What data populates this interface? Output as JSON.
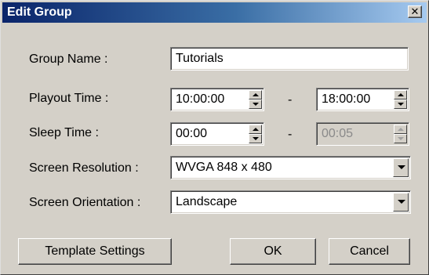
{
  "window": {
    "title": "Edit Group",
    "close_glyph": "✕"
  },
  "form": {
    "group_name": {
      "label": "Group Name :",
      "value": "Tutorials"
    },
    "playout_time": {
      "label": "Playout Time :",
      "start": "10:00:00",
      "separator": "-",
      "end": "18:00:00"
    },
    "sleep_time": {
      "label": "Sleep Time :",
      "start": "00:00",
      "separator": "-",
      "end": "00:05",
      "end_disabled": true
    },
    "screen_resolution": {
      "label": "Screen Resolution :",
      "value": "WVGA 848 x 480"
    },
    "screen_orientation": {
      "label": "Screen Orientation :",
      "value": "Landscape"
    }
  },
  "buttons": {
    "template_settings": "Template Settings",
    "ok": "OK",
    "cancel": "Cancel"
  },
  "colors": {
    "titlebar_start": "#0a246a",
    "titlebar_end": "#a6caf0",
    "dialog_bg": "#d4d0c8"
  }
}
